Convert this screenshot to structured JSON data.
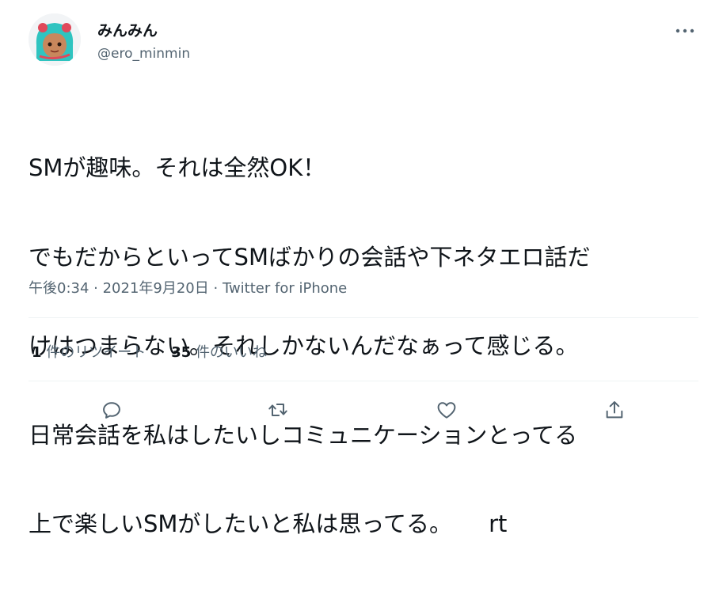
{
  "author": {
    "display_name": "みんみん",
    "handle": "@ero_minmin",
    "avatar_icon": "avatar-anime-girl-teal-hair"
  },
  "tweet": {
    "lines": [
      "SMが趣味。それは全然OK！",
      "でもだからといってSMばかりの会話や下ネタエロ話だ",
      "けはつまらない。それしかないんだなぁって感じる。",
      "日常会話を私はしたいしコミュニケーションとってる",
      "上で楽しいSMがしたいと私は思ってる。     rt"
    ]
  },
  "meta": {
    "time": "午後0:34",
    "separator": " · ",
    "date": "2021年9月20日",
    "source": "Twitter for iPhone"
  },
  "stats": {
    "retweets_count": "1",
    "retweets_label": " 件のリツイート",
    "likes_count": "35",
    "likes_label": " 件のいいね"
  },
  "actions": {
    "reply_icon": "reply-icon",
    "retweet_icon": "retweet-icon",
    "like_icon": "like-icon",
    "share_icon": "share-icon",
    "more_icon": "more-icon"
  },
  "colors": {
    "text": "#0f1419",
    "secondary": "#536471",
    "divider": "#eff3f4"
  }
}
